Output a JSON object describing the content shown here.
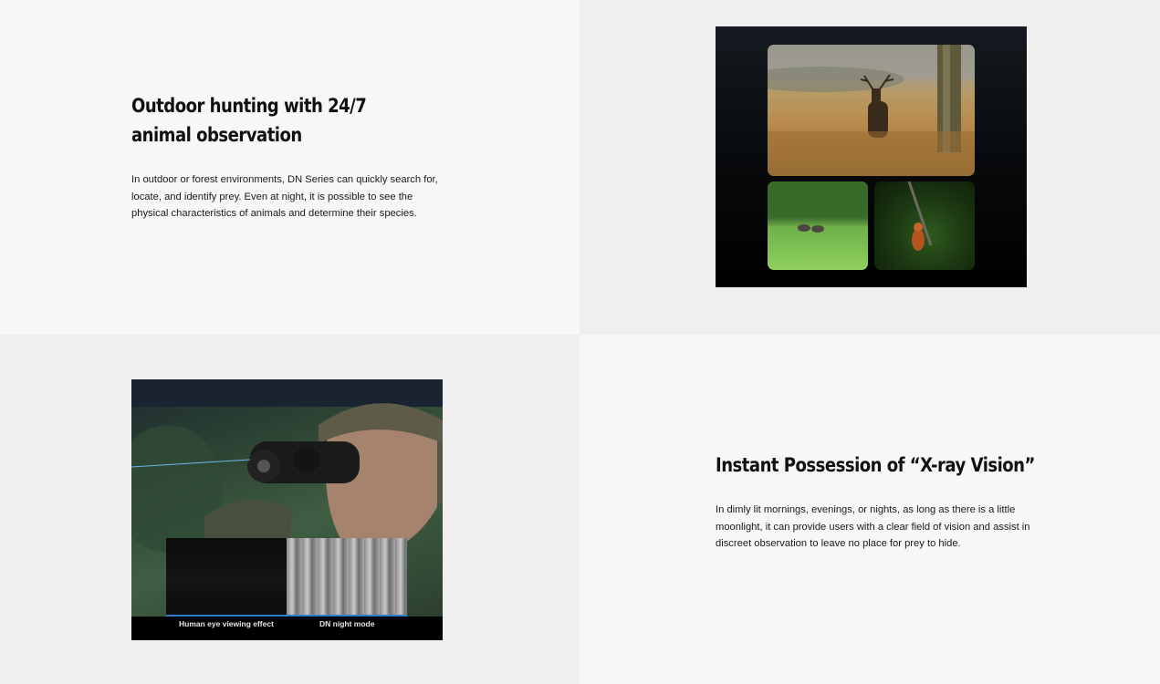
{
  "section_hunting": {
    "heading": "Outdoor hunting with 24/7 animal observation",
    "body": "In outdoor or forest environments, DN Series can quickly search for, locate, and identify prey. Even at night, it is possible to see the physical characteristics of animals and determine their species."
  },
  "section_xray": {
    "heading": "Instant Possession of “X-ray Vision”",
    "body": "In dimly lit mornings, evenings, or nights, as long as there is a little moonlight, it can provide users with a clear field of vision and assist in discreet observation to leave no place for prey to hide."
  },
  "comparison": {
    "human_label": "Human eye viewing effect",
    "night_label": "DN night mode"
  },
  "colors": {
    "panel_light": "#f7f7f7",
    "panel_dark": "#efefef",
    "divider_accent": "#2f7fc8"
  }
}
